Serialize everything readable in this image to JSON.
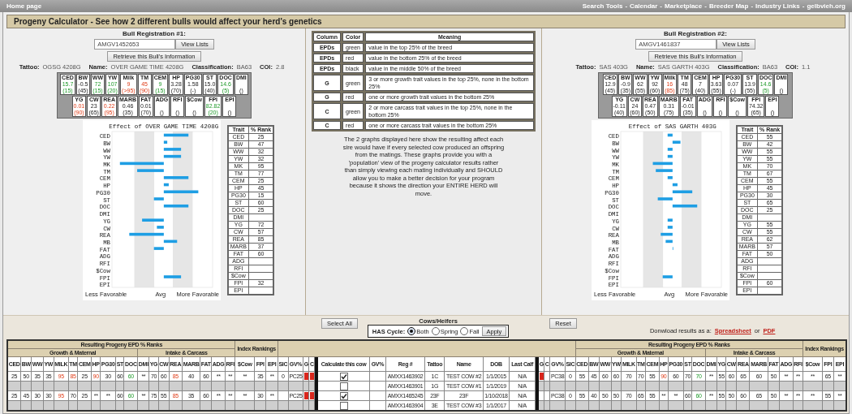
{
  "nav": {
    "home": "Home page",
    "separator": "-",
    "links": [
      "Search Tools",
      "Calendar",
      "Marketplace",
      "Breeder Map",
      "Industry Links",
      "gelbvieh.org"
    ]
  },
  "title": "Progeny Calculator - See how 2 different bulls would affect your herd's genetics",
  "bulls": [
    {
      "heading": "Bull Registration #1:",
      "registration": "AMGV1452653",
      "view_button": "View Lists",
      "retrieve_button": "Retrieve this Bull's Information",
      "info": [
        {
          "label": "Tattoo:",
          "value": "OGSG 4208G"
        },
        {
          "label": "Name:",
          "value": "OVER GAME TIME 4208G"
        },
        {
          "label": "Classification:",
          "value": "BA63"
        },
        {
          "label": "COI:",
          "value": "2.8"
        }
      ],
      "epds": [
        {
          "trait": "CED",
          "value": "15.7",
          "rank": "(15)",
          "top_quarter": true,
          "bottom_quarter": false
        },
        {
          "trait": "BW",
          "value": "-0.5",
          "rank": "(45)",
          "top_quarter": false,
          "bottom_quarter": false
        },
        {
          "trait": "WW",
          "value": "72",
          "rank": "(15)",
          "top_quarter": true,
          "bottom_quarter": false
        },
        {
          "trait": "YW",
          "value": "107",
          "rank": "(20)",
          "top_quarter": true,
          "bottom_quarter": false
        },
        {
          "trait": "Milk",
          "value": "9",
          "rank": "(>95)",
          "top_quarter": false,
          "bottom_quarter": true
        },
        {
          "trait": "TM",
          "value": "45",
          "rank": "(90)",
          "top_quarter": false,
          "bottom_quarter": true
        },
        {
          "trait": "CEM",
          "value": "9",
          "rank": "(15)",
          "top_quarter": true,
          "bottom_quarter": false
        },
        {
          "trait": "HP",
          "value": "3.28",
          "rank": "(70)",
          "top_quarter": false,
          "bottom_quarter": false
        },
        {
          "trait": "PG30",
          "value": "1.58",
          "rank": "(-)",
          "top_quarter": false,
          "bottom_quarter": false
        },
        {
          "trait": "ST",
          "value": "15.0",
          "rank": "(40)",
          "top_quarter": false,
          "bottom_quarter": false
        },
        {
          "trait": "DOC",
          "value": "14.6",
          "rank": "(5)",
          "top_quarter": true,
          "bottom_quarter": false
        },
        {
          "trait": "DMI",
          "rank": "()",
          "top_quarter": false,
          "bottom_quarter": false
        },
        {
          "trait": "YG",
          "value": "0.01",
          "rank": "(90)",
          "top_quarter": false,
          "bottom_quarter": true
        },
        {
          "trait": "CW",
          "value": "23",
          "rank": "(65)",
          "top_quarter": false,
          "bottom_quarter": false
        },
        {
          "trait": "REA",
          "value": "0.22",
          "rank": "(95)",
          "top_quarter": false,
          "bottom_quarter": true
        },
        {
          "trait": "MARB",
          "value": "0.46",
          "rank": "(35)",
          "top_quarter": false,
          "bottom_quarter": false
        },
        {
          "trait": "FAT",
          "value": "0.01",
          "rank": "(70)",
          "top_quarter": false,
          "bottom_quarter": false
        },
        {
          "trait": "ADG",
          "rank": "()",
          "top_quarter": false,
          "bottom_quarter": false
        },
        {
          "trait": "RFI",
          "rank": "()",
          "top_quarter": false,
          "bottom_quarter": false
        },
        {
          "trait": "$Cow",
          "rank": "()",
          "top_quarter": false,
          "bottom_quarter": false
        },
        {
          "trait": "FPI",
          "value": "82.82",
          "rank": "(20)",
          "top_quarter": true,
          "bottom_quarter": false
        },
        {
          "trait": "EPI",
          "rank": "()",
          "top_quarter": false,
          "bottom_quarter": false
        }
      ],
      "chart": {
        "title": "Effect of OVER GAME TIME 4208G",
        "traits": [
          "CED",
          "BW",
          "WW",
          "YW",
          "MK",
          "TM",
          "CEM",
          "HP",
          "PG30",
          "ST",
          "DOC",
          "DMI",
          "YG",
          "CW",
          "REA",
          "MB",
          "FAT",
          "ADG",
          "RFI",
          "$Cow",
          "FPI",
          "EPI"
        ],
        "left_label": "Less Favorable",
        "mid_label": "Avg",
        "right_label": "More Favorable"
      },
      "rank_table": {
        "headers": [
          "Trait",
          "% Rank"
        ],
        "rows": [
          {
            "trait": "CED",
            "rank": "25"
          },
          {
            "trait": "BW",
            "rank": "47"
          },
          {
            "trait": "WW",
            "rank": "32"
          },
          {
            "trait": "YW",
            "rank": "32"
          },
          {
            "trait": "MK",
            "rank": "95"
          },
          {
            "trait": "TM",
            "rank": "77"
          },
          {
            "trait": "CEM",
            "rank": "25"
          },
          {
            "trait": "HP",
            "rank": "45"
          },
          {
            "trait": "PG30",
            "rank": "15"
          },
          {
            "trait": "ST",
            "rank": "60"
          },
          {
            "trait": "DOC",
            "rank": "25"
          },
          {
            "trait": "DMI"
          },
          {
            "trait": "YG",
            "rank": "72"
          },
          {
            "trait": "CW",
            "rank": "57"
          },
          {
            "trait": "REA",
            "rank": "85"
          },
          {
            "trait": "MARB",
            "rank": "37"
          },
          {
            "trait": "FAT",
            "rank": "60"
          },
          {
            "trait": "ADG"
          },
          {
            "trait": "RFI"
          },
          {
            "trait": "$Cow"
          },
          {
            "trait": "FPI",
            "rank": "32"
          },
          {
            "trait": "EPI"
          }
        ]
      }
    },
    {
      "heading": "Bull Registration #2:",
      "registration": "AMGV1461837",
      "view_button": "View Lists",
      "retrieve_button": "Retrieve this Bull's Information",
      "info": [
        {
          "label": "Tattoo:",
          "value": "SAS 403G"
        },
        {
          "label": "Name:",
          "value": "SAS GARTH 403G"
        },
        {
          "label": "Classification:",
          "value": "BA63"
        },
        {
          "label": "COI:",
          "value": "1.1"
        }
      ],
      "epds": [
        {
          "trait": "CED",
          "value": "12.9",
          "rank": "(45)",
          "top_quarter": false,
          "bottom_quarter": false
        },
        {
          "trait": "BW",
          "value": "-0.9",
          "rank": "(35)",
          "top_quarter": false,
          "bottom_quarter": false
        },
        {
          "trait": "WW",
          "value": "62",
          "rank": "(55)",
          "top_quarter": false,
          "bottom_quarter": false
        },
        {
          "trait": "YW",
          "value": "92",
          "rank": "(60)",
          "top_quarter": false,
          "bottom_quarter": false
        },
        {
          "trait": "Milk",
          "value": "16",
          "rank": "(85)",
          "top_quarter": false,
          "bottom_quarter": true
        },
        {
          "trait": "TM",
          "value": "48",
          "rank": "(75)",
          "top_quarter": false,
          "bottom_quarter": false
        },
        {
          "trait": "CEM",
          "value": "7",
          "rank": "(40)",
          "top_quarter": false,
          "bottom_quarter": false
        },
        {
          "trait": "HP",
          "value": "3.63",
          "rank": "(55)",
          "top_quarter": false,
          "bottom_quarter": false
        },
        {
          "trait": "PG30",
          "value": "0.07",
          "rank": "(-)",
          "top_quarter": false,
          "bottom_quarter": false
        },
        {
          "trait": "ST",
          "value": "13.9",
          "rank": "(55)",
          "top_quarter": false,
          "bottom_quarter": false
        },
        {
          "trait": "DOC",
          "value": "14.6",
          "rank": "(5)",
          "top_quarter": true,
          "bottom_quarter": false
        },
        {
          "trait": "DMI",
          "rank": "()",
          "top_quarter": false,
          "bottom_quarter": false
        },
        {
          "trait": "YG",
          "value": "-0.11",
          "rank": "(40)",
          "top_quarter": false,
          "bottom_quarter": false
        },
        {
          "trait": "CW",
          "value": "24",
          "rank": "(60)",
          "top_quarter": false,
          "bottom_quarter": false
        },
        {
          "trait": "REA",
          "value": "0.47",
          "rank": "(50)",
          "top_quarter": false,
          "bottom_quarter": false
        },
        {
          "trait": "MARB",
          "value": "0.31",
          "rank": "(75)",
          "top_quarter": false,
          "bottom_quarter": false
        },
        {
          "trait": "FAT",
          "value": "-0.01",
          "rank": "(35)",
          "top_quarter": false,
          "bottom_quarter": false
        },
        {
          "trait": "ADG",
          "rank": "()",
          "top_quarter": false,
          "bottom_quarter": false
        },
        {
          "trait": "RFI",
          "rank": "()",
          "top_quarter": false,
          "bottom_quarter": false
        },
        {
          "trait": "$Cow",
          "rank": "()",
          "top_quarter": false,
          "bottom_quarter": false
        },
        {
          "trait": "FPI",
          "value": "74.32",
          "rank": "(65)",
          "top_quarter": false,
          "bottom_quarter": false
        },
        {
          "trait": "EPI",
          "rank": "()",
          "top_quarter": false,
          "bottom_quarter": false
        }
      ],
      "chart": {
        "title": "Effect of SAS GARTH 403G",
        "traits": [
          "CED",
          "BW",
          "WW",
          "YW",
          "MK",
          "TM",
          "CEM",
          "HP",
          "PG30",
          "ST",
          "DOC",
          "DMI",
          "YG",
          "CW",
          "REA",
          "MB",
          "FAT",
          "ADG",
          "RFI",
          "$Cow",
          "FPI",
          "EPI"
        ],
        "left_label": "Less Favorable",
        "mid_label": "Avg",
        "right_label": "More Favorable"
      },
      "rank_table": {
        "headers": [
          "Trait",
          "% Rank"
        ],
        "rows": [
          {
            "trait": "CED",
            "rank": "55"
          },
          {
            "trait": "BW",
            "rank": "42"
          },
          {
            "trait": "WW",
            "rank": "55"
          },
          {
            "trait": "YW",
            "rank": "55"
          },
          {
            "trait": "MK",
            "rank": "70"
          },
          {
            "trait": "TM",
            "rank": "67"
          },
          {
            "trait": "CEM",
            "rank": "55"
          },
          {
            "trait": "HP",
            "rank": "45"
          },
          {
            "trait": "PG30",
            "rank": "30"
          },
          {
            "trait": "ST",
            "rank": "65"
          },
          {
            "trait": "DOC",
            "rank": "25"
          },
          {
            "trait": "DMI"
          },
          {
            "trait": "YG",
            "rank": "55"
          },
          {
            "trait": "CW",
            "rank": "55"
          },
          {
            "trait": "REA",
            "rank": "62"
          },
          {
            "trait": "MARB",
            "rank": "57"
          },
          {
            "trait": "FAT",
            "rank": "50"
          },
          {
            "trait": "ADG"
          },
          {
            "trait": "RFI"
          },
          {
            "trait": "$Cow"
          },
          {
            "trait": "FPI",
            "rank": "60"
          },
          {
            "trait": "EPI"
          }
        ]
      }
    }
  ],
  "legend": {
    "headers": [
      "Column",
      "Color",
      "Meaning"
    ],
    "rows": [
      {
        "column": "EPDs",
        "color_label": "green",
        "meaning": "value in the top 25% of the breed"
      },
      {
        "column": "EPDs",
        "color_label": "red",
        "meaning": "value in the bottom 25% of the breed"
      },
      {
        "column": "EPDs",
        "color_label": "black",
        "meaning": "value in the middle 50% of the breed"
      },
      {
        "column": "G",
        "color_label": "green",
        "meaning": "3 or more growth trait values in the top 25%, none in the bottom 25%"
      },
      {
        "column": "G",
        "color_label": "red",
        "meaning": "one or more growth trait values in the bottom 25%"
      },
      {
        "column": "C",
        "color_label": "green",
        "meaning": "2 or more carcass trait values in the top 25%, none in the bottom 25%"
      },
      {
        "column": "C",
        "color_label": "red",
        "meaning": "one or more carcass trait values in the bottom 25%"
      }
    ],
    "note": "The 2 graphs displayed here show the resulting affect each sire would have if every selected cow produced an offspring from the matings. These graphs provide you with a 'population' view of the progeny calculator results rather than simply viewing each mating individually and SHOULD allow you to make a better decision for your program because it shows the direction your ENTIRE HERD will move."
  },
  "controls": {
    "select_all": "Select All",
    "group_title": "Cows/Heifers",
    "cycle_label": "HAS Cycle:",
    "cycle_options": [
      {
        "label": "Both",
        "selected": true
      },
      {
        "label": "Spring",
        "selected": false
      },
      {
        "label": "Fall",
        "selected": false
      }
    ],
    "apply": "Apply",
    "reset": "Reset",
    "download_text": "Donwload results as a:",
    "download_links": [
      "Spreadsheet",
      "PDF"
    ],
    "download_joiner": "or"
  },
  "table": {
    "left_header": {
      "title": "Resulting Progeny EPD % Ranks",
      "index_title": "Index Rankings",
      "groups": [
        "Growth & Maternal",
        "Intake & Carcass"
      ]
    },
    "right_header": {
      "title": "Resulting Progeny EPD % Ranks",
      "index_title": "Index Rankings",
      "groups": [
        "Growth & Maternal",
        "Intake & Carcass"
      ]
    },
    "left_columns": [
      "CED",
      "BW",
      "WW",
      "YW",
      "MILK",
      "TM",
      "CEM",
      "HP",
      "PG30",
      "ST",
      "DOC",
      "DMI",
      "YG",
      "CW",
      "REA",
      "MARB",
      "FAT",
      "ADG",
      "RFI",
      "$Cow",
      "FPI",
      "EPI",
      "SIC",
      "GV%",
      "G",
      "C"
    ],
    "middle_columns": [
      "Calculate this cow",
      "GV%",
      "Reg #",
      "Tattoo",
      "Name",
      "DOB",
      "Last Calf"
    ],
    "right_columns": [
      "G",
      "C",
      "GV%",
      "SIC",
      "CED",
      "BW",
      "WW",
      "YW",
      "MILK",
      "TM",
      "CEM",
      "HP",
      "PG30",
      "ST",
      "DOC",
      "DMI",
      "YG",
      "CW",
      "REA",
      "MARB",
      "FAT",
      "ADG",
      "RFI",
      "$Cow",
      "FPI",
      "EPI"
    ],
    "rows": [
      {
        "checked": true,
        "reg": "AMXX1463902",
        "tattoo": "1C",
        "name": "TEST COW #2",
        "dob": "1/1/2015",
        "last_calf": "N/A",
        "left": {
          "traits": [
            "25",
            "50",
            "35",
            "35",
            {
              "text": "95",
              "top_quarter": false,
              "bottom_quarter": true
            },
            {
              "text": "85",
              "top_quarter": false,
              "bottom_quarter": true
            },
            "25",
            {
              "text": "90",
              "top_quarter": false,
              "bottom_quarter": true
            },
            "30",
            "60",
            {
              "text": "60",
              "top_quarter": true,
              "bottom_quarter": false
            },
            "**",
            "70",
            "60",
            {
              "text": "85",
              "top_quarter": false,
              "bottom_quarter": true
            },
            "40",
            "60",
            "**",
            "**",
            "**",
            "35",
            "**"
          ],
          "sic": "0",
          "gv": "PC25",
          "g_flag": {
            "color": "#d8261c"
          },
          "c_flag": {
            "color": "#d8261c"
          }
        },
        "right": {
          "traits": [
            "55",
            "45",
            "60",
            "60",
            "70",
            "70",
            "55",
            {
              "text": "90",
              "top_quarter": false,
              "bottom_quarter": true
            },
            "60",
            "70",
            {
              "text": "70",
              "top_quarter": true,
              "bottom_quarter": false
            },
            "**",
            "55",
            "60",
            "65",
            "60",
            "50",
            "**",
            "**",
            "**",
            "65",
            "**"
          ],
          "sic": "0",
          "gv": "PC38",
          "g_flag": {
            "color": "#d8261c"
          }
        }
      },
      {
        "checked": false,
        "reg": "AMXX1463901",
        "tattoo": "1G",
        "name": "TEST COW #1",
        "dob": "1/1/2019",
        "last_calf": "N/A"
      },
      {
        "checked": true,
        "reg": "AMXX1465245",
        "tattoo": "23F",
        "name": "23F",
        "dob": "1/10/2018",
        "last_calf": "N/A",
        "left": {
          "traits": [
            "25",
            "45",
            "30",
            "30",
            {
              "text": "95",
              "top_quarter": false,
              "bottom_quarter": true
            },
            "70",
            "25",
            "**",
            "**",
            "60",
            {
              "text": "60",
              "top_quarter": true,
              "bottom_quarter": false
            },
            "**",
            "75",
            "55",
            {
              "text": "85",
              "top_quarter": false,
              "bottom_quarter": true
            },
            "35",
            "60",
            "**",
            "**",
            "**",
            "30",
            "**"
          ],
          "gv": "PC25",
          "g_flag": {
            "color": "#d8261c"
          },
          "c_flag": {
            "color": "#d8261c"
          }
        },
        "right": {
          "traits": [
            "55",
            "40",
            "50",
            "50",
            "70",
            "65",
            "55",
            "**",
            "**",
            "60",
            {
              "text": "60",
              "top_quarter": true,
              "bottom_quarter": false
            },
            "**",
            "55",
            "50",
            "60",
            "65",
            "50",
            "**",
            "**",
            "**",
            "55",
            "**"
          ],
          "sic": "0",
          "gv": "PC38"
        }
      },
      {
        "checked": false,
        "reg": "AMXX1463904",
        "tattoo": "3E",
        "name": "TEST COW #3",
        "dob": "1/1/2017",
        "last_calf": "N/A"
      }
    ]
  }
}
